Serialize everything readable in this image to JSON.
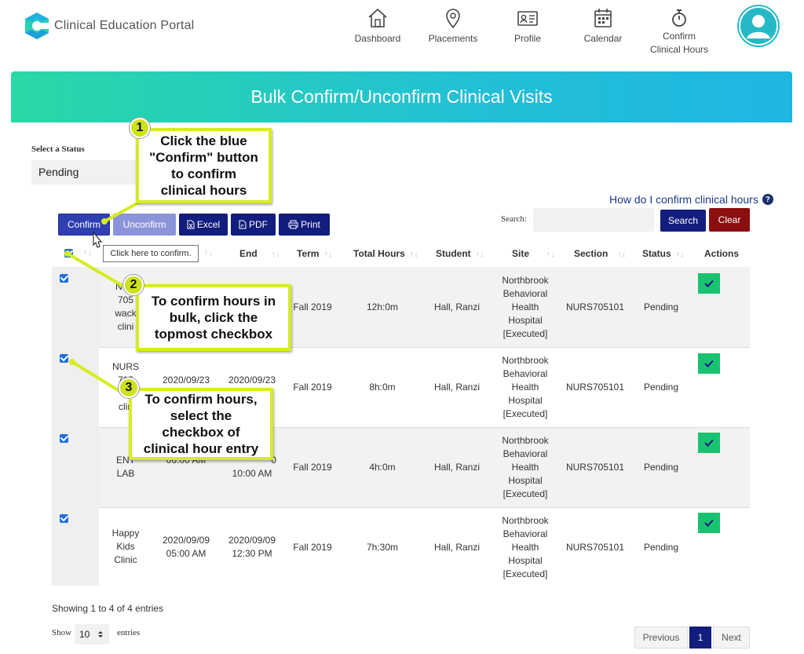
{
  "header": {
    "app_name": "Clinical Education Portal",
    "nav": [
      {
        "label": "Dashboard",
        "icon": "home-icon"
      },
      {
        "label": "Placements",
        "icon": "location-pin-icon"
      },
      {
        "label": "Profile",
        "icon": "id-card-icon"
      },
      {
        "label": "Calendar",
        "icon": "calendar-icon"
      },
      {
        "label": "Confirm",
        "label2": "Clinical Hours",
        "icon": "stopwatch-icon"
      }
    ]
  },
  "page_title": "Bulk Confirm/Unconfirm Clinical Visits",
  "status": {
    "label": "Select a Status",
    "value": "Pending"
  },
  "help_link": "How do I confirm clinical hours",
  "toolbar": {
    "confirm": "Confirm",
    "unconfirm": "Unconfirm",
    "excel": "Excel",
    "pdf": "PDF",
    "print": "Print",
    "tooltip": "Click here to confirm."
  },
  "search": {
    "label": "Search:",
    "placeholder": "",
    "search_button": "Search",
    "clear_button": "Clear"
  },
  "table": {
    "headers": {
      "end": "End",
      "term": "Term",
      "total_hours": "Total Hours",
      "student": "Student",
      "site": "Site",
      "section": "Section",
      "status": "Status",
      "actions": "Actions"
    },
    "rows": [
      {
        "site_name": [
          "NUR",
          "705",
          "wack",
          "clini"
        ],
        "start": [
          "",
          ""
        ],
        "end": [
          "",
          ""
        ],
        "term": "Fall 2019",
        "hours": "12h:0m",
        "student": "Hall, Ranzi",
        "site": [
          "Northbrook",
          "Behavioral",
          "Health",
          "Hospital",
          "[Executed]"
        ],
        "section": "NURS705101",
        "status": "Pending"
      },
      {
        "site_name": [
          "NURS",
          "705",
          "w",
          "clin"
        ],
        "start": [
          "2020/09/23",
          ""
        ],
        "end": [
          "2020/09/23",
          ""
        ],
        "term": "Fall 2019",
        "hours": "8h:0m",
        "student": "Hall, Ranzi",
        "site": [
          "Northbrook",
          "Behavioral",
          "Health",
          "Hospital",
          "[Executed]"
        ],
        "section": "NURS705101",
        "status": "Pending"
      },
      {
        "site_name": [
          "ENT",
          "LAB"
        ],
        "start": [
          "",
          "06:00 AM"
        ],
        "end": [
          "0",
          "10:00 AM"
        ],
        "term": "Fall 2019",
        "hours": "4h:0m",
        "student": "Hall, Ranzi",
        "site": [
          "Northbrook",
          "Behavioral",
          "Health",
          "Hospital",
          "[Executed]"
        ],
        "section": "NURS705101",
        "status": "Pending"
      },
      {
        "site_name": [
          "Happy",
          "Kids",
          "Clinic"
        ],
        "start": [
          "2020/09/09",
          "05:00 AM"
        ],
        "end": [
          "2020/09/09",
          "12:30 PM"
        ],
        "term": "Fall 2019",
        "hours": "7h:30m",
        "student": "Hall, Ranzi",
        "site": [
          "Northbrook",
          "Behavioral",
          "Health",
          "Hospital",
          "[Executed]"
        ],
        "section": "NURS705101",
        "status": "Pending"
      }
    ]
  },
  "footer": {
    "showing": "Showing 1 to 4 of 4 entries",
    "show_label": "Show",
    "page_size": "10",
    "entries_label": "entries",
    "previous": "Previous",
    "current_page": "1",
    "next": "Next"
  },
  "callouts": [
    {
      "number": "1",
      "lines": [
        "Click the blue",
        "\"Confirm\" button",
        "to confirm",
        "clinical hours"
      ]
    },
    {
      "number": "2",
      "lines": [
        "To confirm hours in",
        "bulk, click the",
        "topmost checkbox"
      ]
    },
    {
      "number": "3",
      "lines": [
        "To confirm hours,",
        "select the",
        "checkbox of",
        "clinical hour entry"
      ]
    }
  ],
  "colors": {
    "primary": "#121d7d",
    "confirm": "#2f3fb1",
    "clear": "#8b0f0f",
    "action": "#19c270",
    "callout_border": "#d6ec22"
  }
}
